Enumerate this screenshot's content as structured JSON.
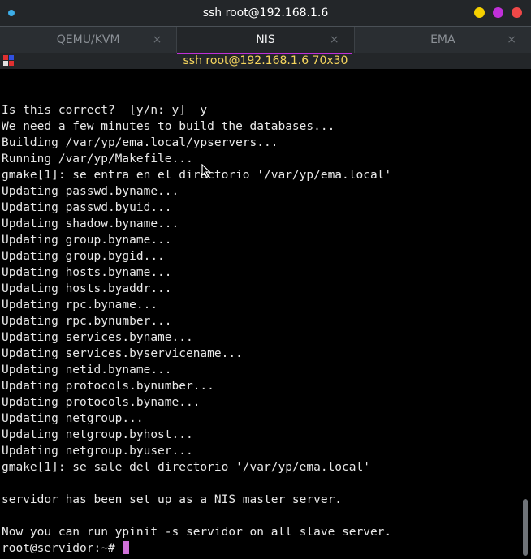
{
  "window": {
    "title": "ssh root@192.168.1.6"
  },
  "colors": {
    "app_dot": "#3daee9",
    "btn_minimize": "#f5d000",
    "btn_maximize": "#c030d8",
    "btn_close": "#f04848",
    "tab_indicator": "#c030d8",
    "cursor": "#d070d8"
  },
  "tabs": [
    {
      "label": "QEMU/KVM",
      "active": false
    },
    {
      "label": "NIS",
      "active": true
    },
    {
      "label": "EMA",
      "active": false
    }
  ],
  "tab_close_glyph": "×",
  "status": {
    "text": "ssh root@192.168.1.6 70x30"
  },
  "terminal": {
    "lines": [
      "",
      "",
      "Is this correct?  [y/n: y]  y",
      "We need a few minutes to build the databases...",
      "Building /var/yp/ema.local/ypservers...",
      "Running /var/yp/Makefile...",
      "gmake[1]: se entra en el directorio '/var/yp/ema.local'",
      "Updating passwd.byname...",
      "Updating passwd.byuid...",
      "Updating shadow.byname...",
      "Updating group.byname...",
      "Updating group.bygid...",
      "Updating hosts.byname...",
      "Updating hosts.byaddr...",
      "Updating rpc.byname...",
      "Updating rpc.bynumber...",
      "Updating services.byname...",
      "Updating services.byservicename...",
      "Updating netid.byname...",
      "Updating protocols.bynumber...",
      "Updating protocols.byname...",
      "Updating netgroup...",
      "Updating netgroup.byhost...",
      "Updating netgroup.byuser...",
      "gmake[1]: se sale del directorio '/var/yp/ema.local'",
      "",
      "servidor has been set up as a NIS master server.",
      "",
      "Now you can run ypinit -s servidor on all slave server."
    ],
    "prompt": "root@servidor:~# "
  }
}
